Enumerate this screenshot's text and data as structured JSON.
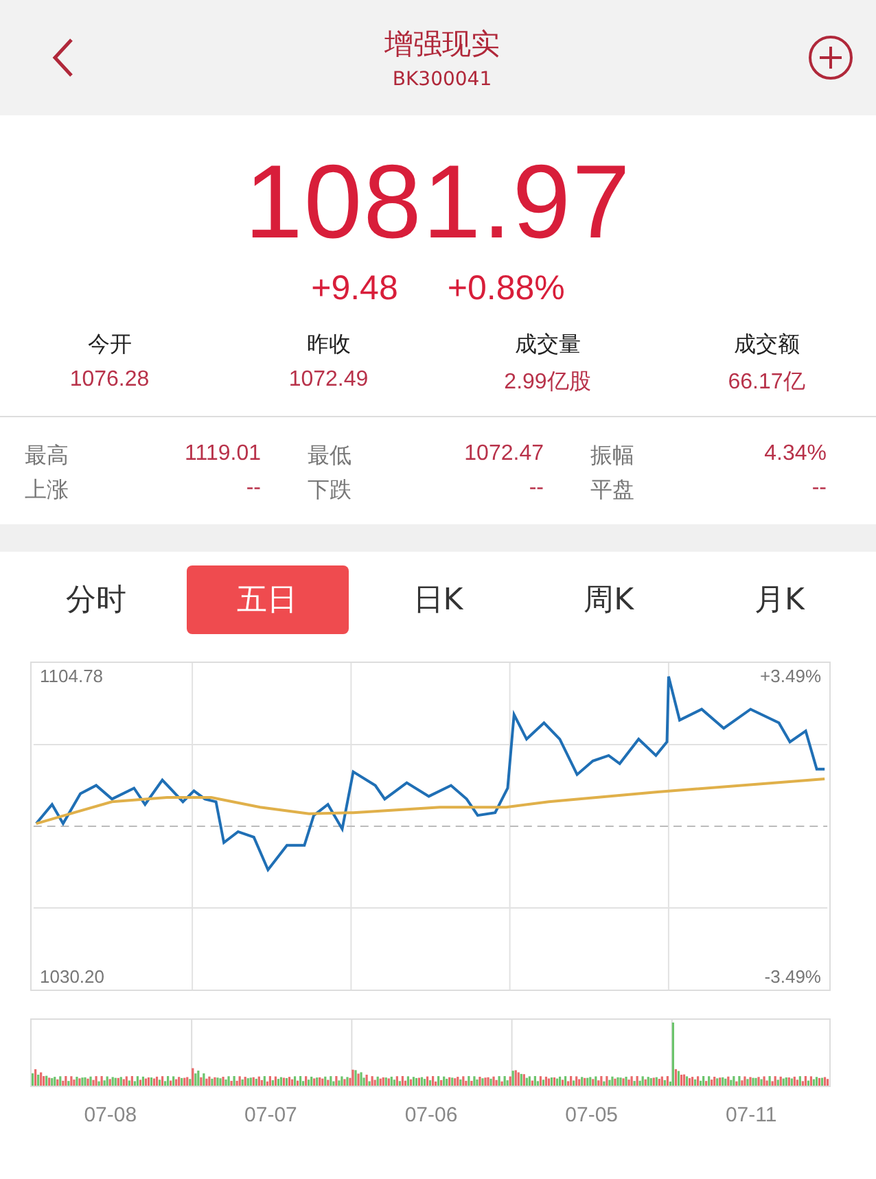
{
  "header": {
    "title": "增强现实",
    "code": "BK300041"
  },
  "quote": {
    "price": "1081.97",
    "change": "+9.48",
    "change_pct": "+0.88%"
  },
  "stats": [
    {
      "label": "今开",
      "value": "1076.28"
    },
    {
      "label": "昨收",
      "value": "1072.49"
    },
    {
      "label": "成交量",
      "value": "2.99亿股"
    },
    {
      "label": "成交额",
      "value": "66.17亿"
    }
  ],
  "details": [
    {
      "label": "最高",
      "value": "1119.01"
    },
    {
      "label": "最低",
      "value": "1072.47"
    },
    {
      "label": "振幅",
      "value": "4.34%"
    },
    {
      "label": "上涨",
      "value": "--"
    },
    {
      "label": "下跌",
      "value": "--"
    },
    {
      "label": "平盘",
      "value": "--"
    }
  ],
  "tabs": [
    {
      "label": "分时",
      "selected": false
    },
    {
      "label": "五日",
      "selected": true
    },
    {
      "label": "日K",
      "selected": false
    },
    {
      "label": "周K",
      "selected": false
    },
    {
      "label": "月K",
      "selected": false
    }
  ],
  "chart": {
    "high_label": "1104.78",
    "low_label": "1030.20",
    "high_pct": "+3.49%",
    "low_pct": "-3.49%"
  },
  "volume": {
    "dates": [
      "07-08",
      "07-07",
      "07-06",
      "07-05",
      "07-11"
    ]
  }
}
